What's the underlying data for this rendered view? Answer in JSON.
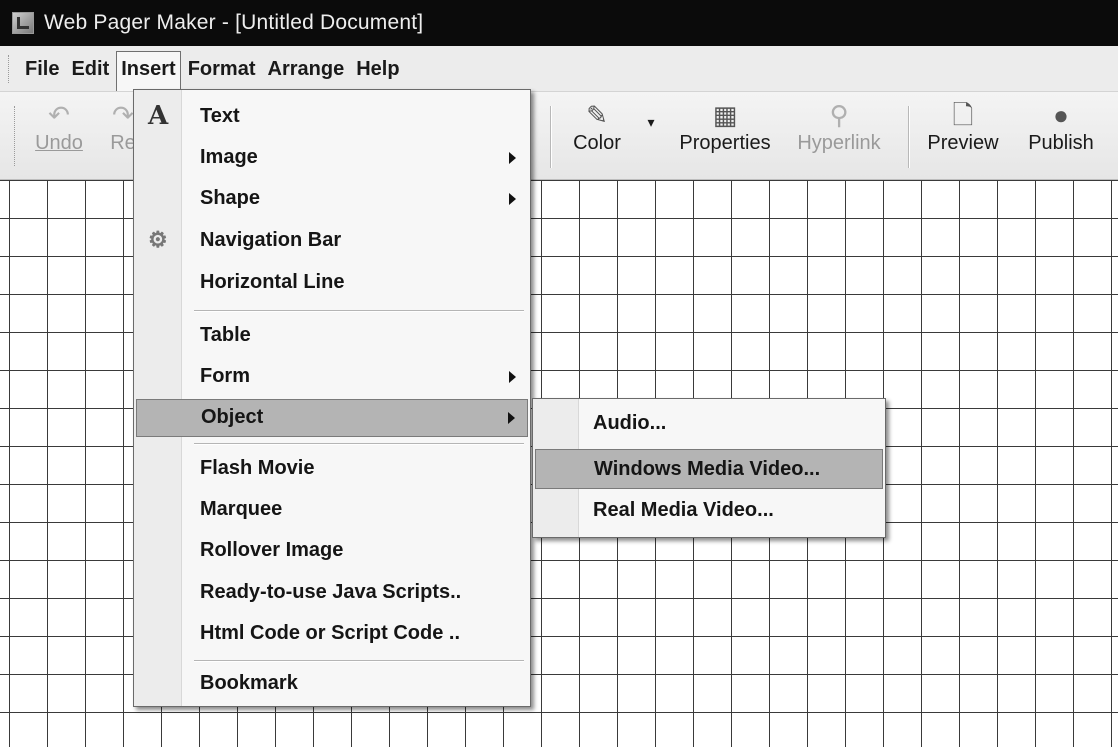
{
  "window": {
    "title": "Web Pager Maker - [Untitled Document]"
  },
  "menubar": {
    "items": [
      "File",
      "Edit",
      "Insert",
      "Format",
      "Arrange",
      "Help"
    ],
    "open": "Insert"
  },
  "toolbar": {
    "undo": "Undo",
    "redo": "Re",
    "color": "Color",
    "properties": "Properties",
    "hyperlink": "Hyperlink",
    "preview": "Preview",
    "publish": "Publish"
  },
  "insert_menu": {
    "items": [
      {
        "label": "Text",
        "icon": "text-icon"
      },
      {
        "label": "Image",
        "submenu": true
      },
      {
        "label": "Shape",
        "submenu": true
      },
      {
        "label": "Navigation Bar",
        "icon": "navigation-bar-icon"
      },
      {
        "label": "Horizontal Line"
      },
      {
        "label": "Table"
      },
      {
        "label": "Form",
        "submenu": true
      },
      {
        "label": "Object",
        "submenu": true,
        "highlighted": true
      },
      {
        "label": "Flash Movie"
      },
      {
        "label": "Marquee"
      },
      {
        "label": "Rollover Image"
      },
      {
        "label": "Ready-to-use Java Scripts.."
      },
      {
        "label": "Html Code or Script Code .."
      },
      {
        "label": "Bookmark"
      }
    ]
  },
  "object_submenu": {
    "items": [
      {
        "label": "Audio..."
      },
      {
        "label": "Windows Media Video...",
        "highlighted": true
      },
      {
        "label": "Real Media Video..."
      }
    ]
  }
}
